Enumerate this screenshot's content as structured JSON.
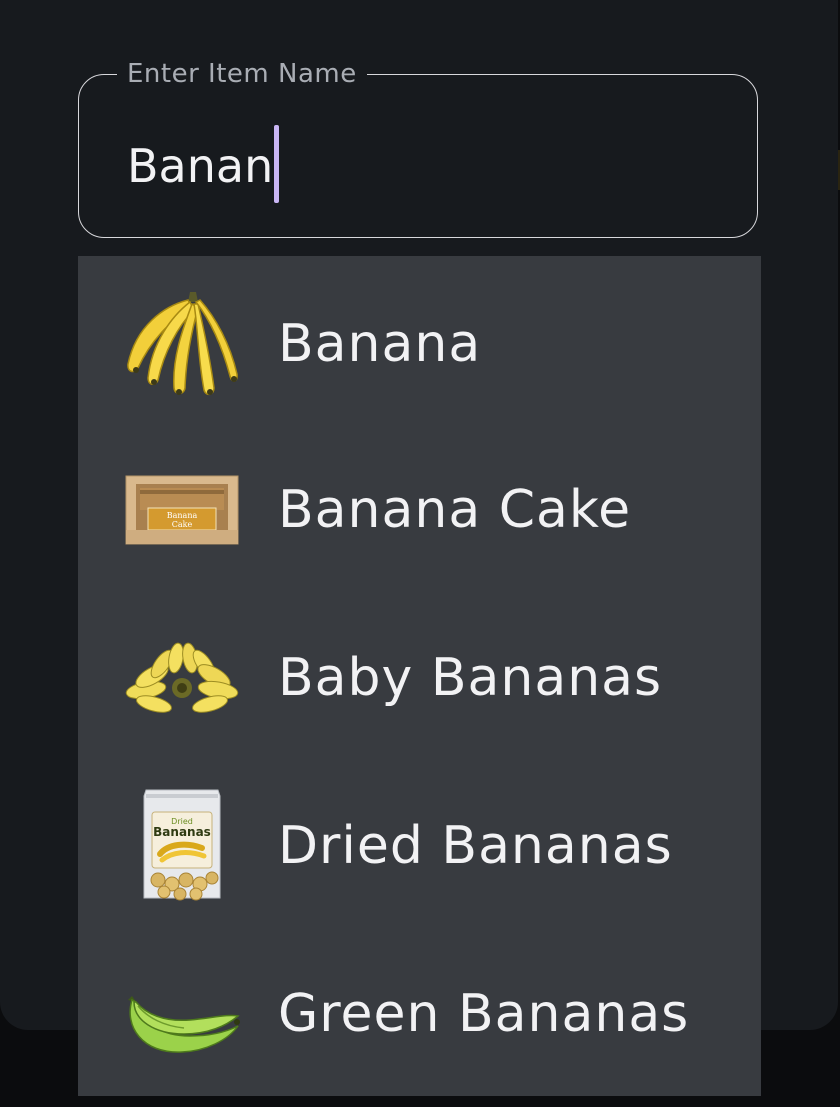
{
  "input": {
    "label": "Enter Item Name",
    "value": "Banan"
  },
  "suggestions": [
    {
      "label": "Banana",
      "icon": "banana-bunch-icon"
    },
    {
      "label": "Banana Cake",
      "icon": "banana-cake-box-icon"
    },
    {
      "label": "Baby Bananas",
      "icon": "baby-bananas-icon"
    },
    {
      "label": "Dried Bananas",
      "icon": "dried-bananas-bag-icon"
    },
    {
      "label": "Green Bananas",
      "icon": "green-bananas-icon"
    }
  ],
  "product_text": {
    "cake_box_label_line1": "Banana",
    "cake_box_label_line2": "Cake",
    "dried_bag_line1": "Dried",
    "dried_bag_line2": "Bananas"
  },
  "colors": {
    "dialog_background": "#171a1e",
    "dropdown_background": "#383b40",
    "text_primary": "#f2f2f4",
    "label_text": "#a9adb4",
    "cursor": "#c9b6f5",
    "field_border": "#d8d8dc"
  }
}
